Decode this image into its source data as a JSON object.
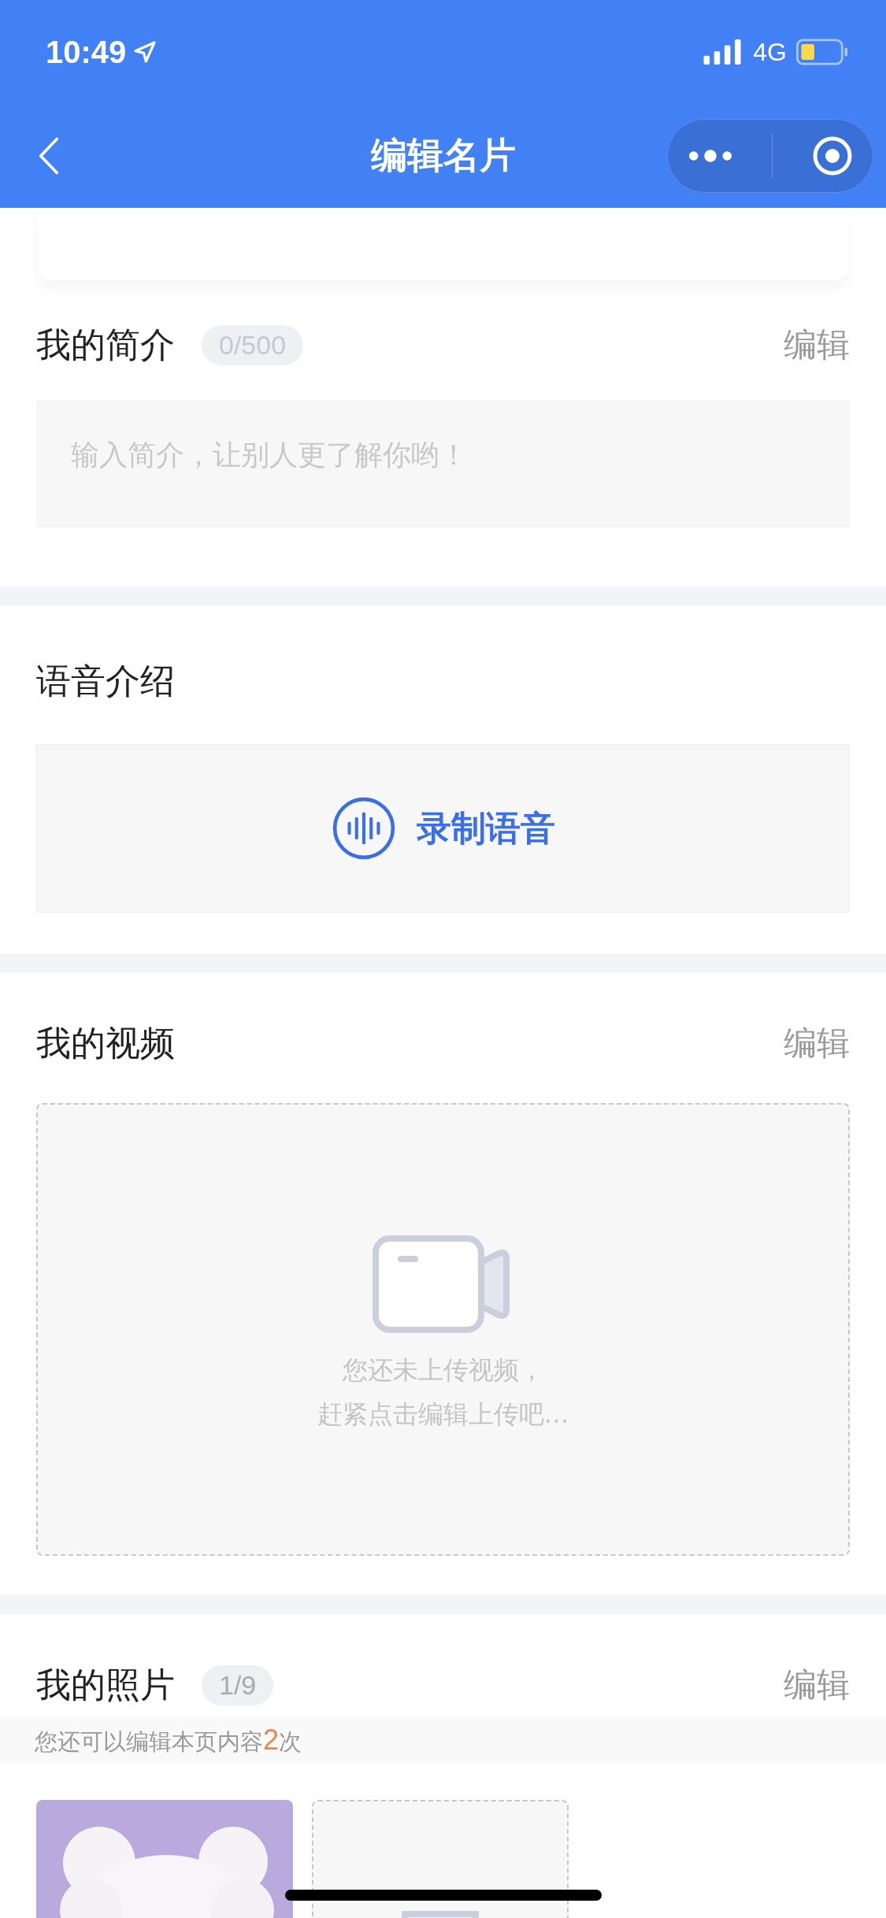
{
  "status_bar": {
    "time": "10:49",
    "network": "4G"
  },
  "nav_bar": {
    "title": "编辑名片"
  },
  "sections": [
    {
      "kind": "intro",
      "title": "我的简介",
      "badge": "0/500",
      "action": "编辑",
      "field": {
        "placeholder": "输入简介，让别人更了解你哟！"
      }
    },
    {
      "kind": "voice",
      "title": "语音介绍",
      "button": "录制语音"
    },
    {
      "kind": "video",
      "title": "我的视频",
      "action": "编辑",
      "empty_lines": [
        "您还未上传视频，",
        "赶紧点击编辑上传吧…"
      ]
    },
    {
      "kind": "photos",
      "title": "我的照片",
      "badge": "1/9",
      "action": "编辑",
      "notice": {
        "text_before": "您还可以编辑本页内容",
        "count": "2",
        "text_after": "次"
      },
      "photos": [
        {
          "kind": "picture"
        },
        {
          "kind": "add"
        }
      ]
    }
  ]
}
